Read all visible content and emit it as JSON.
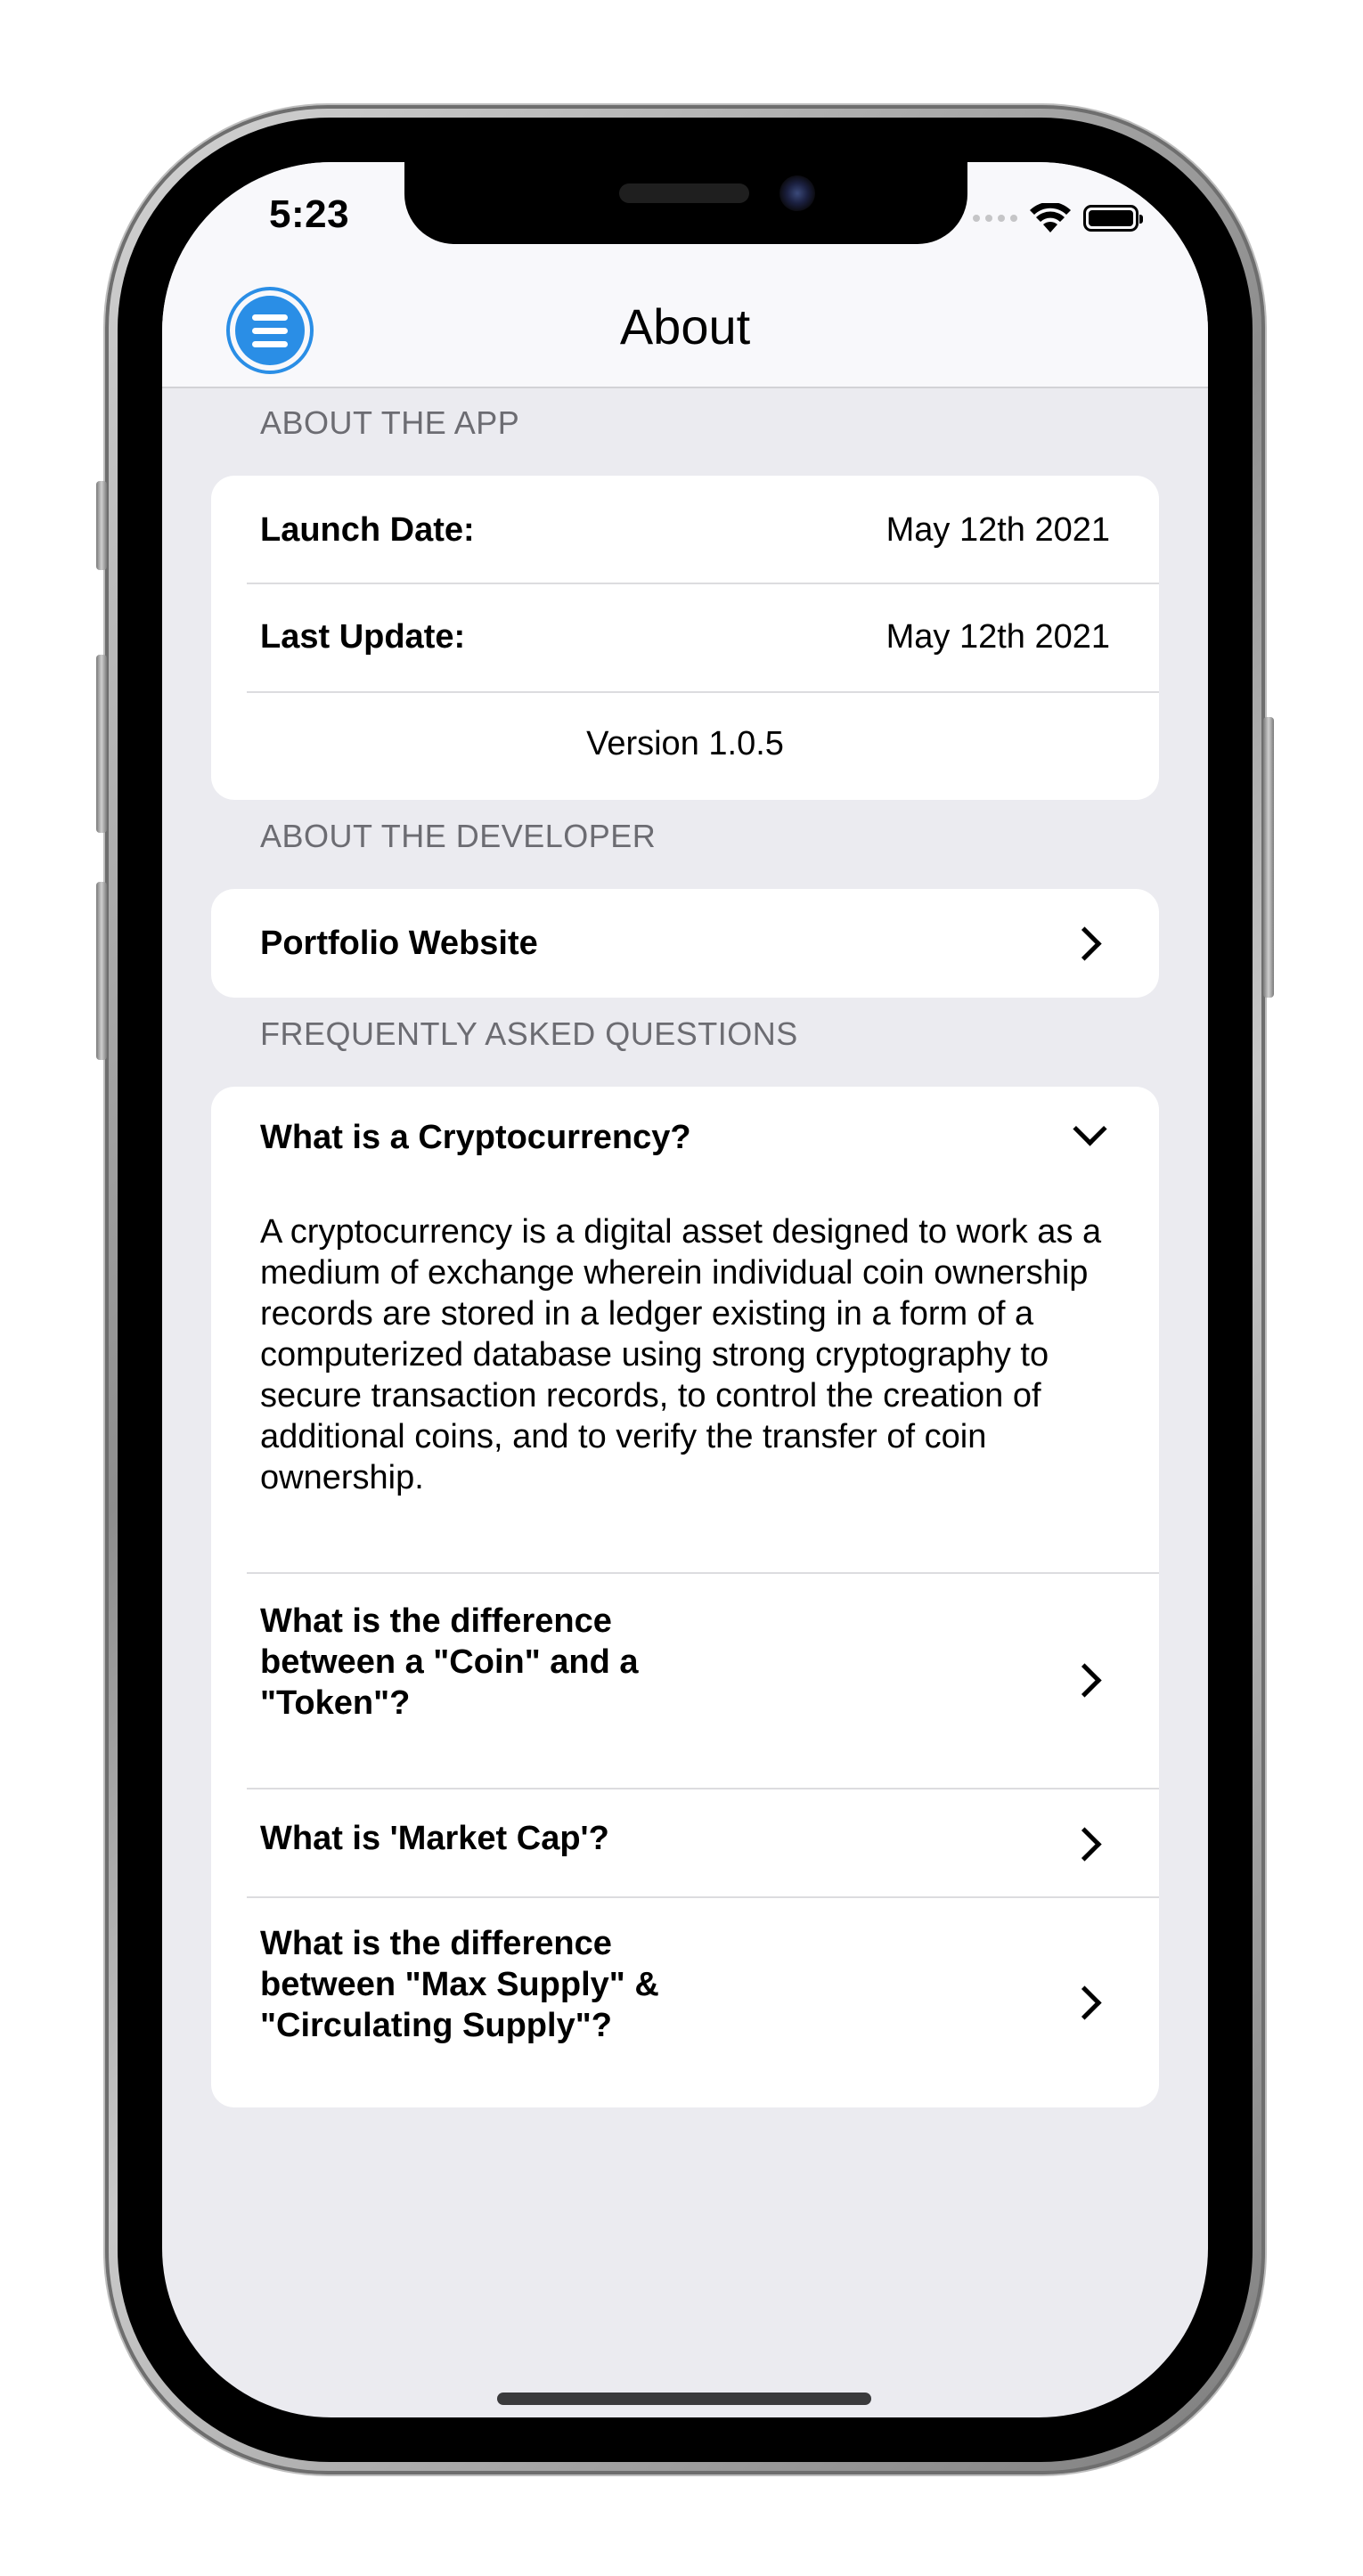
{
  "status_bar": {
    "time": "5:23"
  },
  "nav": {
    "title": "About",
    "menu_icon": "menu-lines-icon"
  },
  "about_app": {
    "header": "ABOUT THE APP",
    "launch_label": "Launch Date:",
    "launch_value": "May 12th 2021",
    "update_label": "Last Update:",
    "update_value": "May 12th 2021",
    "version": "Version 1.0.5"
  },
  "about_developer": {
    "header": "ABOUT THE DEVELOPER",
    "portfolio_label": "Portfolio Website"
  },
  "faq": {
    "header": "FREQUENTLY ASKED QUESTIONS",
    "items": [
      {
        "question": "What is a Cryptocurrency?",
        "expanded": true,
        "answer": "A cryptocurrency is a digital asset designed to work as a medium of exchange wherein individual coin ownership records are stored in a ledger existing in a form of a computerized database using strong cryptography to secure transaction records, to control the creation of additional coins, and to verify the transfer of coin ownership."
      },
      {
        "question": "What is the difference between a \"Coin\" and a \"Token\"?",
        "expanded": false
      },
      {
        "question": "What is 'Market Cap'?",
        "expanded": false
      },
      {
        "question": "What is the difference between \"Max Supply\" & \"Circulating Supply\"?",
        "expanded": false
      }
    ]
  },
  "colors": {
    "accent": "#2a8ee6",
    "background": "#ebebf0",
    "card": "#ffffff",
    "secondary_text": "#6c6c72"
  }
}
